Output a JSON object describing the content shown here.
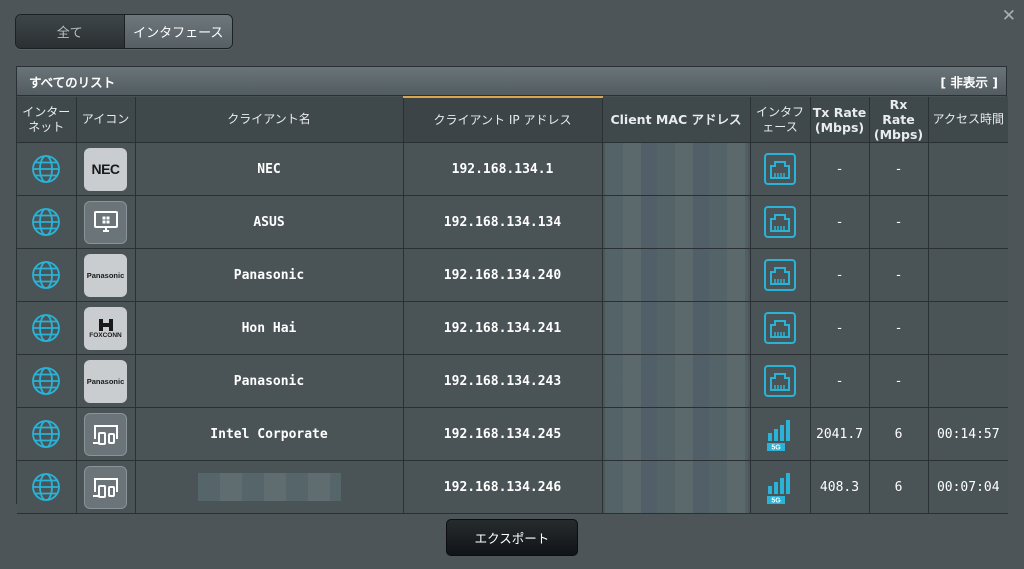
{
  "tabs": {
    "all": "全て",
    "interface": "インタフェース"
  },
  "panel": {
    "title": "すべてのリスト",
    "hide_label": "[ 非表示 ]"
  },
  "columns": {
    "internet": "インターネット",
    "icon": "アイコン",
    "client_name": "クライアント名",
    "client_ip": "クライアント IP アドレス",
    "client_mac": "Client MAC アドレス",
    "interface": "インタフェース",
    "tx_rate": "Tx Rate (Mbps)",
    "rx_rate": "Rx Rate (Mbps)",
    "access_time": "アクセス時間"
  },
  "rows": [
    {
      "name": "NEC",
      "icon": "nec-logo",
      "icon_text": "NEC",
      "ip": "192.168.134.1",
      "iface": "ethernet",
      "tx": "-",
      "rx": "-",
      "time": ""
    },
    {
      "name": "ASUS",
      "icon": "windows-pc-icon",
      "ip": "192.168.134.134",
      "iface": "ethernet",
      "tx": "-",
      "rx": "-",
      "time": ""
    },
    {
      "name": "Panasonic",
      "icon": "panasonic-logo",
      "icon_text": "Panasonic",
      "ip": "192.168.134.240",
      "iface": "ethernet",
      "tx": "-",
      "rx": "-",
      "time": ""
    },
    {
      "name": "Hon Hai",
      "icon": "foxconn-logo",
      "icon_text": "FOXCONN",
      "ip": "192.168.134.241",
      "iface": "ethernet",
      "tx": "-",
      "rx": "-",
      "time": ""
    },
    {
      "name": "Panasonic",
      "icon": "panasonic-logo",
      "icon_text": "Panasonic",
      "ip": "192.168.134.243",
      "iface": "ethernet",
      "tx": "-",
      "rx": "-",
      "time": ""
    },
    {
      "name": "Intel Corporate",
      "icon": "generic-device-icon",
      "ip": "192.168.134.245",
      "iface": "wifi-5g",
      "iface_label": "5G",
      "tx": "2041.7",
      "rx": "6",
      "time": "00:14:57"
    },
    {
      "name": "",
      "icon": "generic-device-icon",
      "ip": "192.168.134.246",
      "iface": "wifi-5g",
      "iface_label": "5G",
      "tx": "408.3",
      "rx": "6",
      "time": "00:07:04"
    }
  ],
  "export_label": "エクスポート",
  "colors": {
    "accent": "#2ab3d6",
    "sort_indicator": "#d9a74a",
    "background": "#4d5558"
  }
}
